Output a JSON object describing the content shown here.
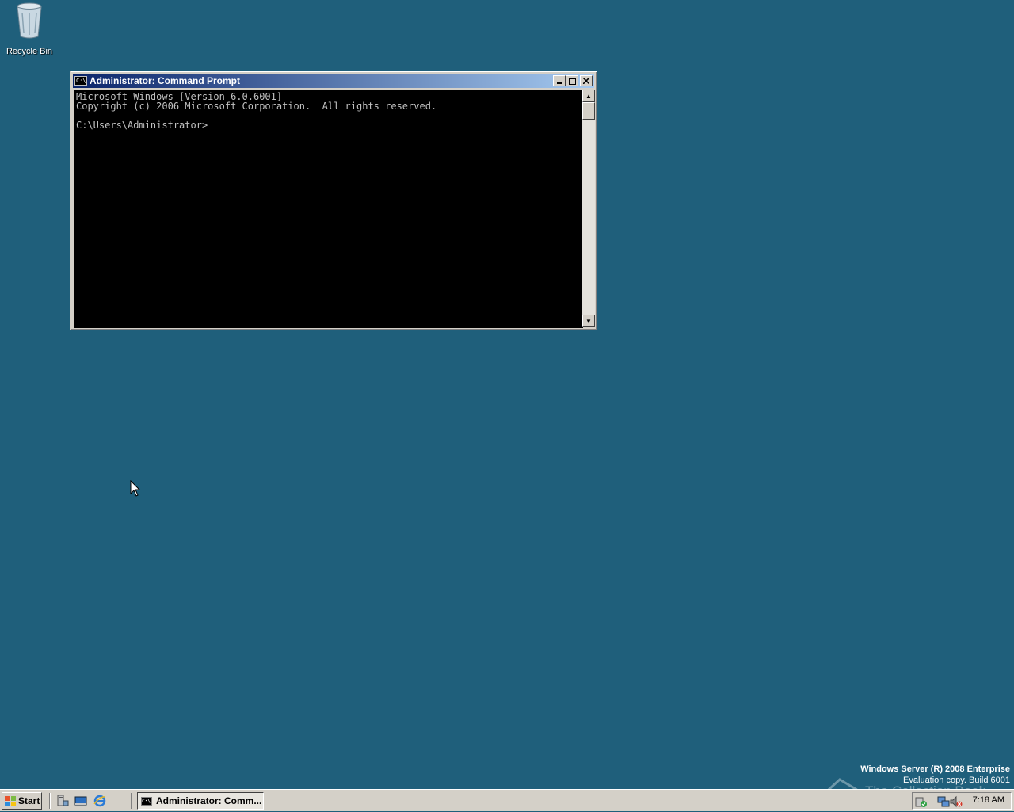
{
  "desktop": {
    "background_color": "#1f5f7b",
    "icons": [
      {
        "label": "Recycle Bin",
        "icon": "recycle-bin-icon"
      }
    ]
  },
  "window": {
    "title": "Administrator: Command Prompt",
    "icon": "command-prompt-icon",
    "controls": {
      "minimize": "minimize-icon",
      "maximize": "maximize-icon",
      "close": "close-icon"
    },
    "console_lines": [
      "Microsoft Windows [Version 6.0.6001]",
      "Copyright (c) 2006 Microsoft Corporation.  All rights reserved.",
      "",
      "C:\\Users\\Administrator>"
    ]
  },
  "watermark": {
    "edition": "Windows Server (R) 2008 Enterprise",
    "build": "Evaluation copy. Build 6001",
    "brand": "The Collection Book"
  },
  "taskbar": {
    "start_label": "Start",
    "quick_launch": [
      "server-manager-icon",
      "show-desktop-icon",
      "internet-explorer-icon"
    ],
    "tasks": [
      {
        "label": "Administrator: Comm...",
        "icon": "command-prompt-icon",
        "active": true
      }
    ],
    "tray": {
      "icons": [
        "security-shield-icon",
        "network-icon",
        "volume-muted-icon"
      ],
      "clock": "7:18 AM"
    }
  }
}
